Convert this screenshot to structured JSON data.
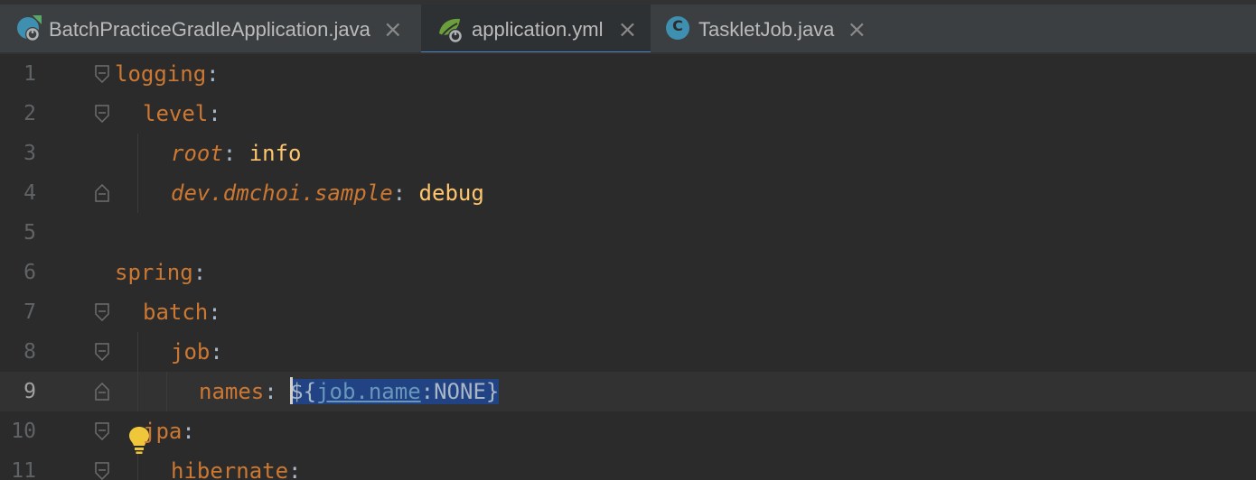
{
  "tabs": [
    {
      "label": "BatchPracticeGradleApplication.java",
      "icon": "spring-boot-app-icon",
      "active": false
    },
    {
      "label": "application.yml",
      "icon": "spring-yaml-icon",
      "active": true
    },
    {
      "label": "TaskletJob.java",
      "icon": "java-class-icon",
      "active": false
    }
  ],
  "close_glyph": "×",
  "class_icon_letter": "C",
  "lines": [
    "1",
    "2",
    "3",
    "4",
    "5",
    "6",
    "7",
    "8",
    "9",
    "10",
    "11"
  ],
  "current_line": "9",
  "code": {
    "l1_key": "logging",
    "l2_key": "level",
    "l3_key": "root",
    "l3_val": "info",
    "l4_key": "dev.dmchoi.sample",
    "l4_val": "debug",
    "l6_key": "spring",
    "l7_key": "batch",
    "l8_key": "job",
    "l9_key": "names",
    "l9_prefix": "${",
    "l9_ref": "job.name",
    "l9_rest": ":NONE}",
    "l10_key": "jpa",
    "l11_key": "hibernate",
    "colon": ":"
  },
  "colors": {
    "key": "#cc7832",
    "value": "#ffc66d",
    "selection": "#214283",
    "tab_underline": "#4a88c7"
  }
}
